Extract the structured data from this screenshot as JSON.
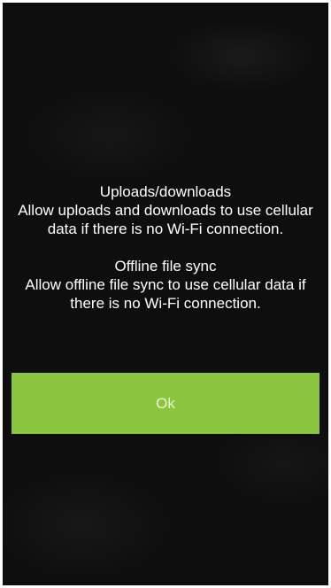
{
  "dialog": {
    "sections": [
      {
        "title": "Uploads/downloads",
        "body": "Allow uploads and downloads to use cellular data if there is no Wi-Fi connection."
      },
      {
        "title": "Offline file sync",
        "body": "Allow offline file sync to use cellular data if there is no Wi-Fi connection."
      }
    ],
    "ok_label": "Ok"
  },
  "colors": {
    "background": "#0e0e0e",
    "accent": "#8bc43f",
    "text": "#ffffff"
  }
}
